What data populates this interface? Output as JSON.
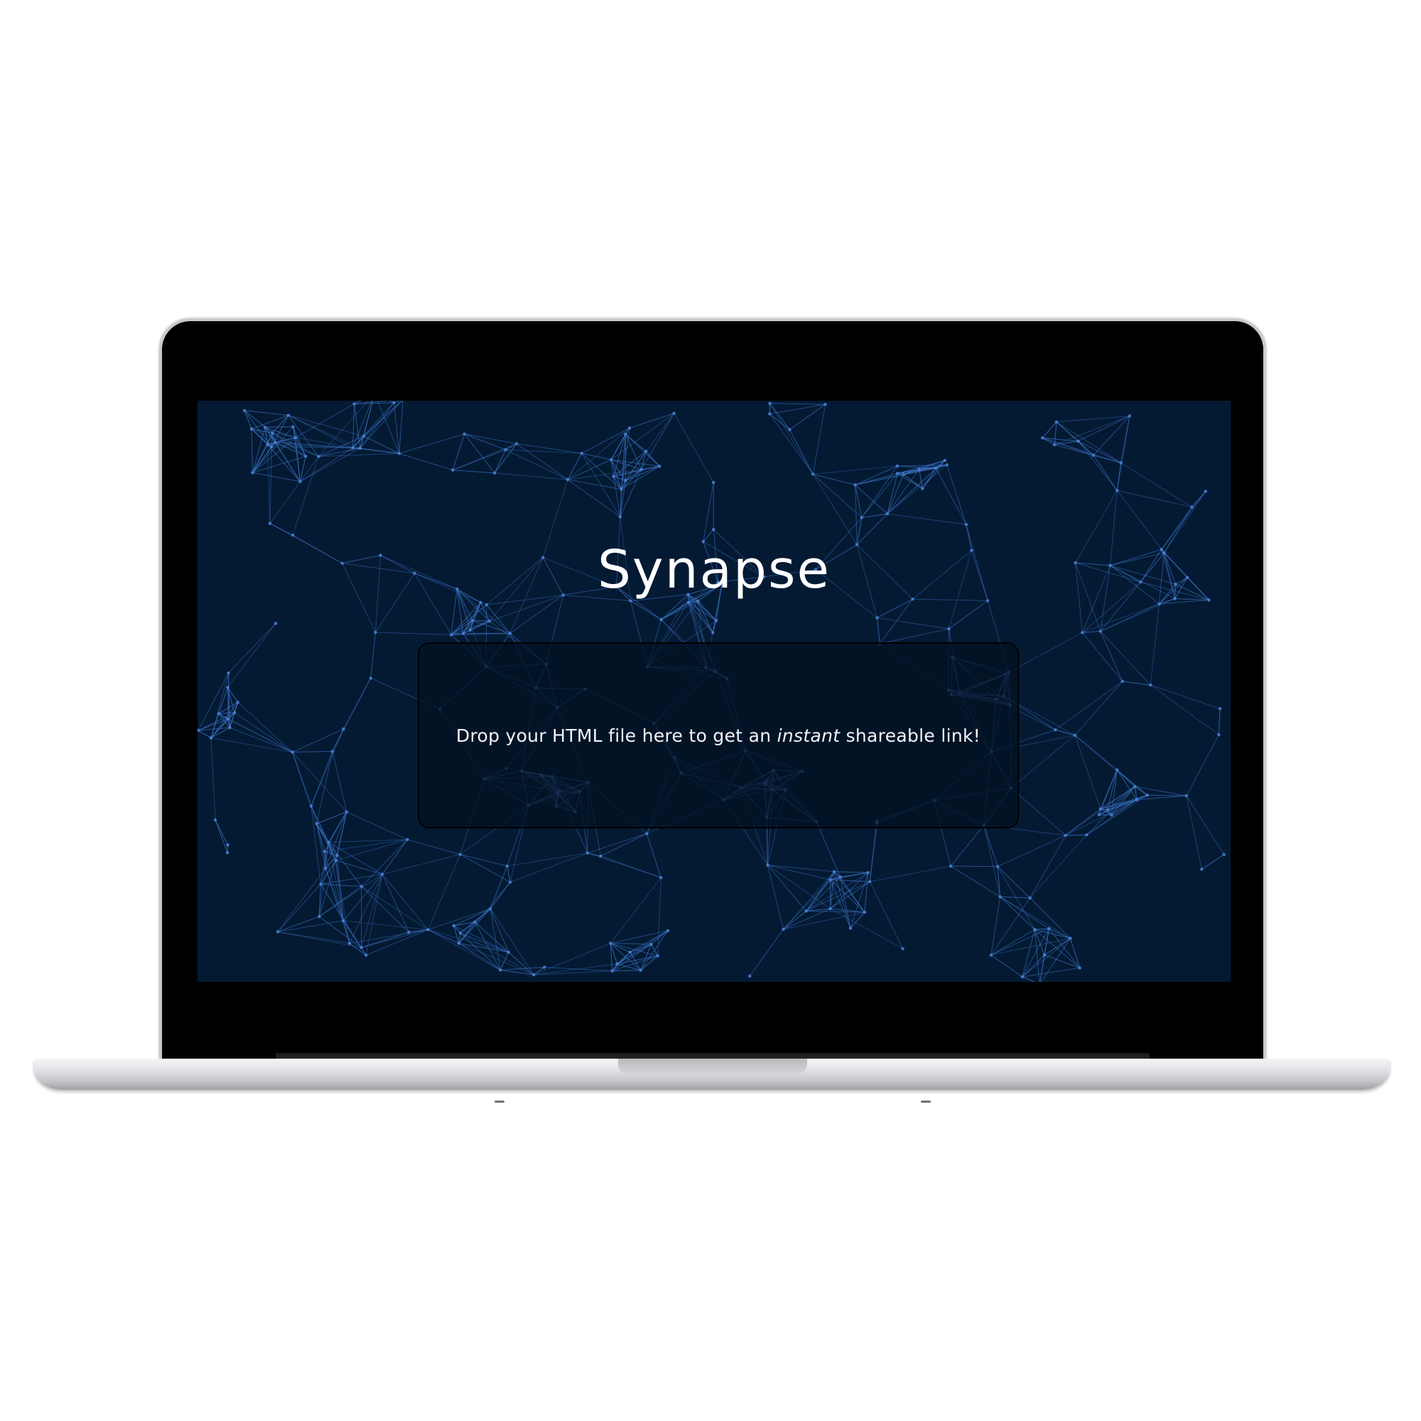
{
  "app": {
    "title": "Synapse"
  },
  "dropzone": {
    "text_before": "Drop your HTML file here to get an",
    "text_emphasis": "instant",
    "text_after": "shareable link!"
  },
  "colors": {
    "screen_background": "#041a33",
    "network_line": "#3b73c4",
    "network_node": "#4a85d8",
    "title_text": "#ffffff"
  }
}
